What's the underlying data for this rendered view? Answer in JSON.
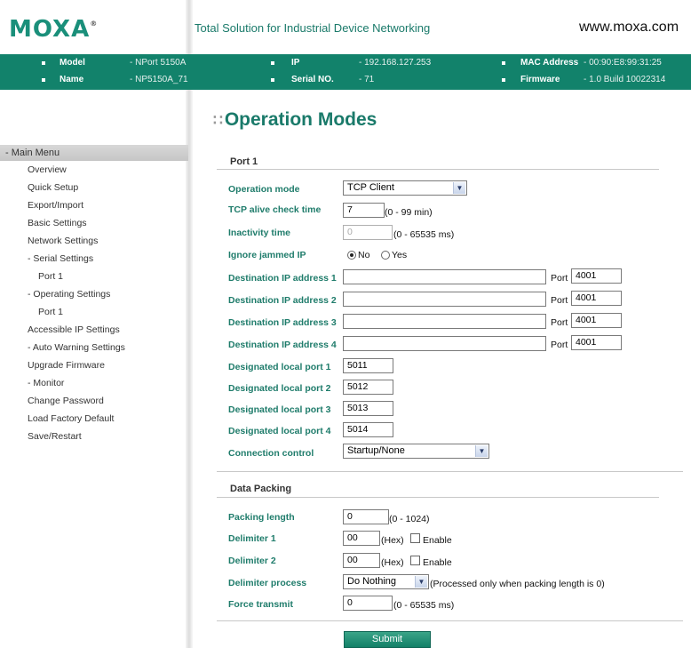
{
  "header": {
    "logo": "MOXA",
    "logo_mark": "®",
    "tagline": "Total Solution for Industrial Device Networking",
    "website": "www.moxa.com"
  },
  "infobar": {
    "model_key": "Model",
    "model_val": "- NPort 5150A",
    "name_key": "Name",
    "name_val": "- NP5150A_71",
    "ip_key": "IP",
    "ip_val": "- 192.168.127.253",
    "serial_key": "Serial NO.",
    "serial_val": "- 71",
    "mac_key": "MAC Address",
    "mac_val": "- 00:90:E8:99:31:25",
    "fw_key": "Firmware",
    "fw_val": "- 1.0 Build 10022314"
  },
  "sidebar": {
    "head": "- Main Menu",
    "items": [
      "Overview",
      "Quick Setup",
      "Export/Import",
      "Basic Settings",
      "Network Settings",
      "- Serial Settings",
      "Port 1",
      "- Operating Settings",
      "Port 1",
      "Accessible IP Settings",
      "- Auto Warning Settings",
      "Upgrade Firmware",
      "- Monitor",
      "Change Password",
      "Load Factory Default",
      "Save/Restart"
    ]
  },
  "page": {
    "title": "Operation Modes",
    "title_mark": "∷",
    "port_section": "Port 1",
    "packing_section": "Data Packing",
    "submit": "Submit"
  },
  "form": {
    "op_mode_label": "Operation mode",
    "op_mode_value": "TCP Client",
    "alive_label": "TCP alive check time",
    "alive_value": "7",
    "alive_hint": "(0 - 99 min)",
    "inactivity_label": "Inactivity time",
    "inactivity_value": "0",
    "inactivity_hint": "(0 - 65535 ms)",
    "jammed_label": "Ignore jammed IP",
    "jammed_no": "No",
    "jammed_yes": "Yes",
    "port_text": "Port",
    "dest": [
      {
        "label": "Destination IP address 1",
        "ip": "",
        "port": "4001"
      },
      {
        "label": "Destination IP address 2",
        "ip": "",
        "port": "4001"
      },
      {
        "label": "Destination IP address 3",
        "ip": "",
        "port": "4001"
      },
      {
        "label": "Destination IP address 4",
        "ip": "",
        "port": "4001"
      }
    ],
    "local": [
      {
        "label": "Designated local port 1",
        "value": "5011"
      },
      {
        "label": "Designated local port 2",
        "value": "5012"
      },
      {
        "label": "Designated local port 3",
        "value": "5013"
      },
      {
        "label": "Designated local port 4",
        "value": "5014"
      }
    ],
    "conn_label": "Connection control",
    "conn_value": "Startup/None",
    "pack_len_label": "Packing length",
    "pack_len_value": "0",
    "pack_len_hint": "(0 - 1024)",
    "delim1_label": "Delimiter 1",
    "delim1_value": "00",
    "delim2_label": "Delimiter 2",
    "delim2_value": "00",
    "hex_hint": "(Hex)",
    "enable_text": "Enable",
    "delim_proc_label": "Delimiter process",
    "delim_proc_value": "Do Nothing",
    "delim_proc_hint": "(Processed only when packing length is 0)",
    "force_label": "Force transmit",
    "force_value": "0",
    "force_hint": "(0 - 65535 ms)"
  }
}
